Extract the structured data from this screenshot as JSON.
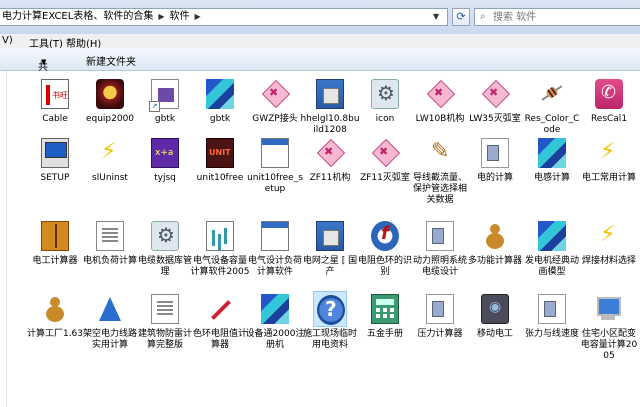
{
  "address_bar": {
    "path": [
      "电力计算EXCEL表格、软件的合集",
      "软件"
    ],
    "search_placeholder": "搜索 软件"
  },
  "menu": {
    "view": "V)",
    "tools": "工具(T)",
    "help": "帮助(H)"
  },
  "toolbar": {
    "share": "共享",
    "new_folder": "新建文件夹"
  },
  "files": [
    {
      "label": "Cable",
      "icon": "cable-app-icon"
    },
    {
      "label": "equip2000",
      "icon": "face-app-icon"
    },
    {
      "label": "gbtk",
      "icon": "tile-app-icon"
    },
    {
      "label": "gbtk",
      "icon": "cubes-app-icon"
    },
    {
      "label": "GWZP接头",
      "icon": "diamond-app-icon"
    },
    {
      "label": "hhelgl10.8build1208",
      "icon": "installer-icon"
    },
    {
      "label": "icon",
      "icon": "gear-app-icon"
    },
    {
      "label": "LW10B机构",
      "icon": "diamond-app-icon"
    },
    {
      "label": "LW35灭弧室",
      "icon": "diamond-app-icon"
    },
    {
      "label": "Res_Color_Code",
      "icon": "resistor-icon"
    },
    {
      "label": "ResCal1",
      "icon": "phone-app-icon"
    },
    {
      "label": "SETUP",
      "icon": "setup-icon"
    },
    {
      "label": "slUninst",
      "icon": "bolt-app-icon"
    },
    {
      "label": "tyjsq",
      "icon": "calculator-app-icon"
    },
    {
      "label": "unit10free",
      "icon": "unit-app-icon"
    },
    {
      "label": "unit10free_setup",
      "icon": "window-app-icon"
    },
    {
      "label": "ZF11机构",
      "icon": "diamond-app-icon"
    },
    {
      "label": "ZF11灭弧室",
      "icon": "diamond-app-icon"
    },
    {
      "label": "导线截流量、保护管选择相关数据",
      "icon": "pen-app-icon"
    },
    {
      "label": "电的计算",
      "icon": "folder-app-icon"
    },
    {
      "label": "电感计算",
      "icon": "cubes-app-icon"
    },
    {
      "label": "电工常用计算",
      "icon": "bolt-app-icon"
    },
    {
      "label": "电工计算器",
      "icon": "book-app-icon"
    },
    {
      "label": "电机负荷计算",
      "icon": "doc-app-icon"
    },
    {
      "label": "电缆数据库管理",
      "icon": "gear-app-icon"
    },
    {
      "label": "电气设备容量计算软件2005",
      "icon": "chart-app-icon"
    },
    {
      "label": "电气设计负荷计算软件",
      "icon": "window-app-icon"
    },
    {
      "label": "电网之星 [ 国产",
      "icon": "installer-icon"
    },
    {
      "label": "电阻色环的识别",
      "icon": "flash-app-icon"
    },
    {
      "label": "动力照明系统电缆设计",
      "icon": "folder-app-icon"
    },
    {
      "label": "多功能计算器",
      "icon": "gourd-app-icon"
    },
    {
      "label": "发电机经典动画模型",
      "icon": "cubes-app-icon"
    },
    {
      "label": "焊接材料选择",
      "icon": "bolt-app-icon"
    },
    {
      "label": "计算工厂1.63",
      "icon": "gourd-app-icon"
    },
    {
      "label": "架空电力线路实用计算",
      "icon": "pyramid-app-icon"
    },
    {
      "label": "建筑物防雷计算完整版",
      "icon": "doc-app-icon"
    },
    {
      "label": "色环电阻值计算器",
      "icon": "pencil-app-icon"
    },
    {
      "label": "设备通2000注册机",
      "icon": "cubes-app-icon"
    },
    {
      "label": "施工现场临时用电资料",
      "icon": "help-icon"
    },
    {
      "label": "五金手册",
      "icon": "calculator-green-icon"
    },
    {
      "label": "压力计算器",
      "icon": "folder-app-icon"
    },
    {
      "label": "移动电工",
      "icon": "camera-app-icon"
    },
    {
      "label": "张力与线速度",
      "icon": "folder-app-icon"
    },
    {
      "label": "住宅小区配变电容量计算2005",
      "icon": "computer-app-icon"
    }
  ]
}
